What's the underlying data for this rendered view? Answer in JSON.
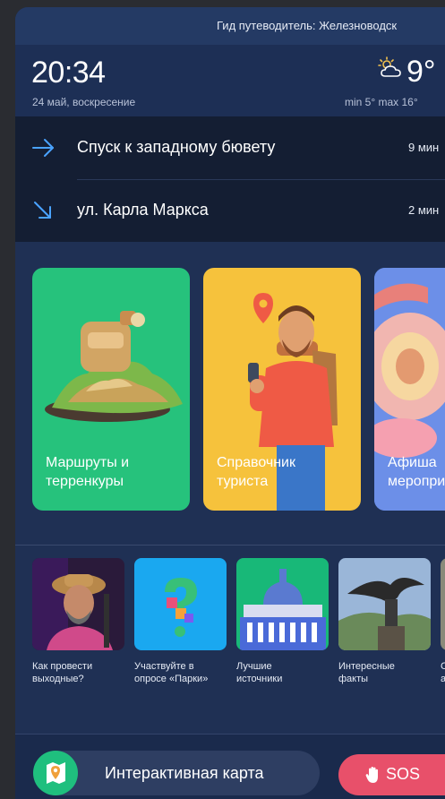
{
  "header": {
    "title": "Гид путеводитель: Железноводск"
  },
  "status": {
    "time": "20:34",
    "date": "24 май, воскресение",
    "weather_icon": "partly-cloudy-icon",
    "temperature": "9°",
    "minmax": "min 5°  max 16°"
  },
  "routes": [
    {
      "icon": "arrow-right-icon",
      "label": "Спуск к западному бювету",
      "time": "9 мин"
    },
    {
      "icon": "arrow-down-right-icon",
      "label": "ул. Карла Маркса",
      "time": "2 мин"
    }
  ],
  "cards": [
    {
      "label_line1": "Маршруты и",
      "label_line2": "терренкуры",
      "color": "#26c27c"
    },
    {
      "label_line1": "Справочник",
      "label_line2": "туриста",
      "color": "#f6c23c"
    },
    {
      "label_line1": "Афиша",
      "label_line2": "мероприятий",
      "color": "#5a8ef0"
    }
  ],
  "tiles": [
    {
      "line1": "Как провести",
      "line2": "выходные?"
    },
    {
      "line1": "Участвуйте в",
      "line2": "опросе «Парки»"
    },
    {
      "line1": "Лучшие",
      "line2": "источники"
    },
    {
      "line1": "Интересные",
      "line2": "факты"
    },
    {
      "line1": "С",
      "line2": "а"
    }
  ],
  "bottom": {
    "map_label": "Интерактивная карта",
    "map_icon": "map-pin-icon",
    "sos_label": "SOS",
    "sos_icon": "hand-icon"
  },
  "colors": {
    "accent_blue": "#4aa3ff",
    "sos": "#e8506a",
    "background": "#1f3054"
  }
}
